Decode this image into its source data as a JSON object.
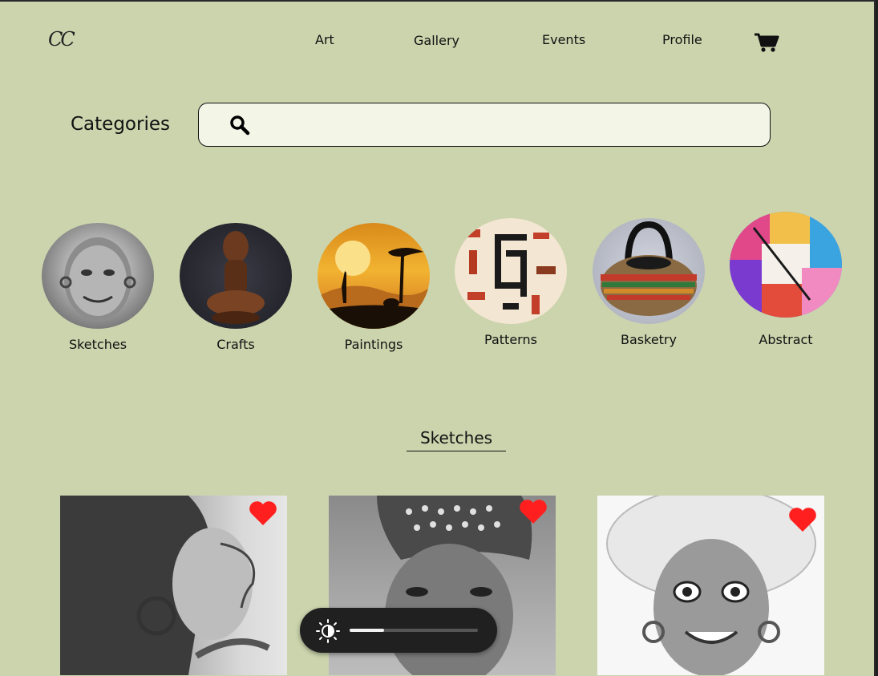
{
  "logo": "CC",
  "nav": {
    "art": "Art",
    "gallery": "Gallery",
    "events": "Events",
    "profile": "Profile",
    "cart_icon": "cart-icon"
  },
  "categories_title": "Categories",
  "search": {
    "placeholder": "",
    "value": "",
    "icon": "search-icon"
  },
  "categories": [
    {
      "label": "Sketches"
    },
    {
      "label": "Crafts"
    },
    {
      "label": "Paintings"
    },
    {
      "label": "Patterns"
    },
    {
      "label": "Basketry"
    },
    {
      "label": "Abstract"
    }
  ],
  "section_title": "Sketches",
  "cards": [
    {
      "favorite": true
    },
    {
      "favorite": true
    },
    {
      "favorite": true
    }
  ],
  "brightness": {
    "icon": "brightness-icon",
    "level": 0.27
  },
  "colors": {
    "background": "#cbd4ad",
    "search_bg": "#f3f6e7",
    "heart": "#ff1f1f",
    "overlay": "#202020"
  }
}
